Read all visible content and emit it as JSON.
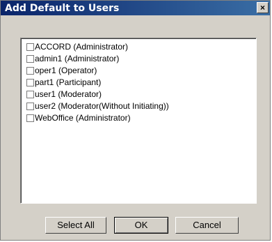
{
  "window": {
    "title": "Add Default to Users",
    "close_glyph": "×"
  },
  "users": [
    {
      "label": "ACCORD (Administrator)",
      "checked": false
    },
    {
      "label": "admin1 (Administrator)",
      "checked": false
    },
    {
      "label": "oper1 (Operator)",
      "checked": false
    },
    {
      "label": "part1 (Participant)",
      "checked": false
    },
    {
      "label": "user1 (Moderator)",
      "checked": false
    },
    {
      "label": "user2 (Moderator(Without Initiating))",
      "checked": false
    },
    {
      "label": "WebOffice (Administrator)",
      "checked": false
    }
  ],
  "buttons": {
    "select_all": "Select All",
    "ok": "OK",
    "cancel": "Cancel"
  },
  "colors": {
    "titlebar_start": "#0a246a",
    "titlebar_end": "#3a6ea5",
    "dialog_bg": "#d4d0c8"
  }
}
